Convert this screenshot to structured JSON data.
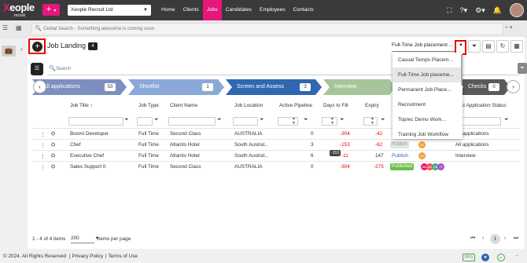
{
  "app": {
    "brand": "Xeople",
    "brand_sub": "recruit",
    "company": "Xeople Recruit Ltd",
    "nav": [
      "Home",
      "Clients",
      "Jobs",
      "Candidates",
      "Employees",
      "Contacts"
    ],
    "active_nav": "Jobs"
  },
  "search": {
    "placeholder": "Global Search - Something awesome is coming soon"
  },
  "page": {
    "title": "Job Landing",
    "count": "4",
    "selected_view": "Full-Time Job placement ...",
    "search_placeholder": "Search"
  },
  "stages": [
    {
      "label": "All applications",
      "count": "53",
      "color": "#7c8fc0"
    },
    {
      "label": "Shortlist",
      "count": "1",
      "color": "#8aa9d8"
    },
    {
      "label": "Screen and Assess",
      "count": "3",
      "color": "#2f67b1"
    },
    {
      "label": "Interview",
      "count": "",
      "color": "#a7c59a"
    },
    {
      "label": "Checks",
      "count": "0",
      "color": "#5a5a5a"
    }
  ],
  "columns": [
    "Job Title",
    "Job Type",
    "Client Name",
    "Job Location",
    "Active Pipeline",
    "Days to Fill",
    "Expiry",
    "Pu",
    "Last Application Status"
  ],
  "rows": [
    {
      "title": "Boomi Developer",
      "type": "Full Time",
      "client": "Second Class",
      "location": "AUSTRALIA",
      "pipeline": "0",
      "days": "-304",
      "expiry": "-42",
      "publish": "",
      "status": "All applications"
    },
    {
      "title": "Chef",
      "type": "Full Time",
      "client": "Atlantis Hotel",
      "location": "South Austral...",
      "pipeline": "3",
      "days": "-153",
      "expiry": "-62",
      "publish": "Publish",
      "status": "All applications"
    },
    {
      "title": "Executive Chef",
      "type": "Full Time",
      "client": "Atlantis Hotel",
      "location": "South Austral...",
      "pipeline": "6",
      "days": "-11",
      "expiry": "147",
      "publish": "Publish",
      "status": "Interview"
    },
    {
      "title": "Sales Support II",
      "type": "Full Time",
      "client": "Second Class",
      "location": "AUSTRALIA",
      "pipeline": "0",
      "days": "-304",
      "expiry": "-275",
      "publish": "Published",
      "status": ""
    }
  ],
  "tooltip": "-153",
  "dropdown": {
    "options": [
      "Casual Temps Placem...",
      "Full-Time Job placeme...",
      "Permanent Job Place...",
      "Recruitment",
      "Toprec     Demo Work...",
      "Training Job Workflow"
    ],
    "selected_index": 1
  },
  "footer": {
    "range": "1 - 4 of 4 items",
    "per_page": "200",
    "per_page_label": "items per page",
    "current_page": "1"
  },
  "bottom": {
    "copyright": "© 2024. All Rights Reserved",
    "privacy": "Privacy Policy",
    "terms": "Terms of Use",
    "badge": "PPG"
  },
  "colors": {
    "accent": "#e5177b",
    "topbar": "#3a3a3a",
    "negative": "#ee0000"
  }
}
